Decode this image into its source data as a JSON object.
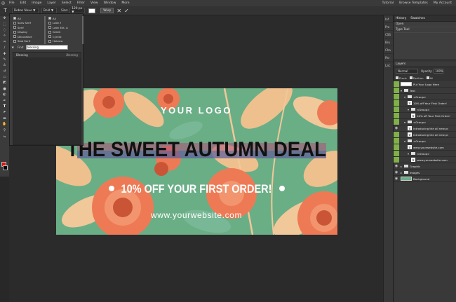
{
  "menubar": {
    "items": [
      "File",
      "Edit",
      "Image",
      "Layer",
      "Select",
      "Filter",
      "View",
      "Window",
      "More"
    ],
    "right_items": [
      "Tutorial",
      "Browse Templates",
      "My Account"
    ]
  },
  "options": {
    "font_name": "Bebas Neue ▼",
    "font_style": "Bold ▼",
    "size_label": "Size:",
    "size_value": "120 px ▼",
    "warp_label": "Warp"
  },
  "font_panel": {
    "filters_left": [
      {
        "label": "All",
        "checked": true
      },
      {
        "label": "Sans Serif",
        "checked": false
      },
      {
        "label": "Serif",
        "checked": false
      },
      {
        "label": "Display",
        "checked": false
      },
      {
        "label": "Decorative",
        "checked": false
      },
      {
        "label": "Slab Serif",
        "checked": false
      }
    ],
    "filters_right": [
      {
        "label": "All",
        "checked": true
      },
      {
        "label": "Latin f",
        "checked": false
      },
      {
        "label": "Latin Ext. A",
        "checked": false
      },
      {
        "label": "Greek",
        "checked": false
      },
      {
        "label": "Cyrillic",
        "checked": false
      },
      {
        "label": "Hebrew",
        "checked": false
      }
    ],
    "find_label": "Find:",
    "find_value": "blessing",
    "results": [
      {
        "name": "Blessing",
        "preview": "Blessing"
      }
    ]
  },
  "canvas": {
    "logo": "YOUR LOGO",
    "headline": "THE SWEET AUTUMN DEAL",
    "offer": "10% OFF YOUR FIRST ORDER!",
    "website": "www.yourwebsite.com",
    "colors": {
      "background": "#6aae86",
      "headline": "#111111",
      "accent": "#ee7a55",
      "leaf": "#f0c89a"
    }
  },
  "minipanel": [
    "Inf",
    "Pro",
    "CSS",
    "Bru",
    "Cha",
    "Par",
    "LaC"
  ],
  "right_panel": {
    "tabs": [
      "History",
      "Swatches"
    ],
    "history": [
      "Open",
      "Type Tool"
    ],
    "layers_title": "Layers",
    "blend_mode": "Normal",
    "opacity_label": "Opacity:",
    "opacity_value": "100%",
    "lock_items": [
      "Pixels",
      "Position",
      "All"
    ]
  },
  "layers": [
    {
      "name": "Put Your Logo Here",
      "kind": "thumb",
      "depth": 0,
      "visible": true
    },
    {
      "name": "Text",
      "kind": "folder",
      "depth": 0,
      "visible": true
    },
    {
      "name": "<Group>",
      "kind": "folder",
      "depth": 1,
      "visible": true
    },
    {
      "name": "10% off Your First Order!",
      "kind": "text",
      "depth": 2,
      "visible": true
    },
    {
      "name": "<Group>",
      "kind": "folder",
      "depth": 2,
      "visible": true
    },
    {
      "name": "10% off Your First Order!",
      "kind": "text",
      "depth": 3,
      "visible": true
    },
    {
      "name": "<Group>",
      "kind": "folder",
      "depth": 1,
      "visible": true
    },
    {
      "name": "Introducing the all new pr",
      "kind": "text",
      "depth": 2,
      "visible": false
    },
    {
      "name": "Introducing the all new pr",
      "kind": "text",
      "depth": 2,
      "visible": true
    },
    {
      "name": "<Group>",
      "kind": "folder",
      "depth": 1,
      "visible": true
    },
    {
      "name": "www.yourwebsite.com",
      "kind": "text",
      "depth": 2,
      "visible": true
    },
    {
      "name": "<Group>",
      "kind": "folder",
      "depth": 2,
      "visible": true
    },
    {
      "name": "www.yourwebsite.com",
      "kind": "text",
      "depth": 3,
      "visible": true
    },
    {
      "name": "Graphic",
      "kind": "folder",
      "depth": 0,
      "visible": false
    },
    {
      "name": "Images",
      "kind": "folder",
      "depth": 0,
      "visible": false
    },
    {
      "name": "Background",
      "kind": "thumb",
      "depth": 0,
      "visible": false
    }
  ]
}
